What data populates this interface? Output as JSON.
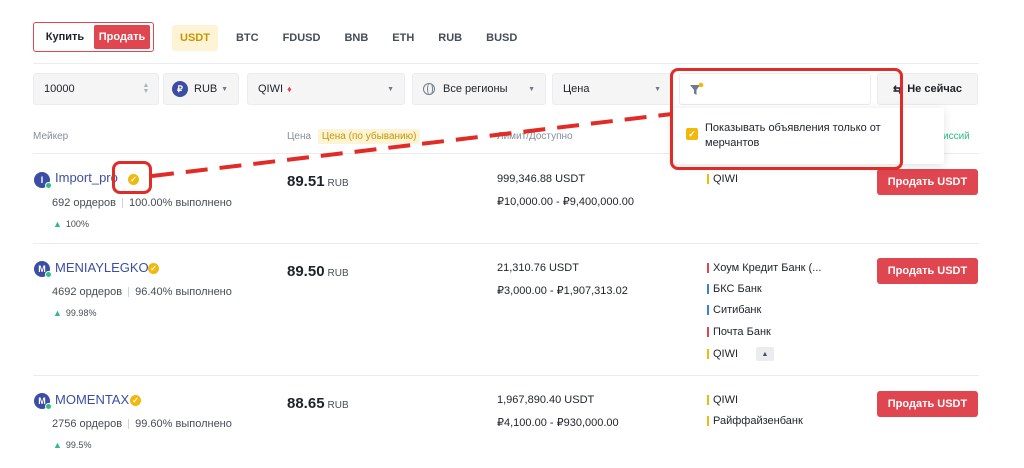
{
  "toggle": {
    "buy": "Купить",
    "sell": "Продать"
  },
  "asset_tabs": [
    "USDT",
    "BTC",
    "FDUSD",
    "BNB",
    "ETH",
    "RUB",
    "BUSD"
  ],
  "filters": {
    "amount": "10000",
    "currency": "RUB",
    "currency_symbol": "₽",
    "payment": "QIWI",
    "region": "Все регионы",
    "sort": "Цена",
    "not_now": "Не сейчас"
  },
  "popup": {
    "checkbox_label": "Показывать объявления только от мерчантов",
    "checked": true
  },
  "table_header": {
    "maker": "Мейкер",
    "price": "Цена",
    "price_order": "Цена (по убыванию)",
    "limit_available": "Лимит/Доступно",
    "no_commission_fragment": "иссий"
  },
  "rows": [
    {
      "avatar_letter": "I",
      "name": "Import_pro",
      "orders": "692 ордеров",
      "completion": "100.00% выполнено",
      "rating": "100%",
      "price": "89.51",
      "price_currency": "RUB",
      "available": "999,346.88 USDT",
      "limits": "₽10,000.00 - ₽9,400,000.00",
      "payments": [
        {
          "name": "QIWI",
          "color": "#f0b90b"
        }
      ],
      "action": "Продать USDT"
    },
    {
      "avatar_letter": "M",
      "name": "MENIAYLEGKO",
      "orders": "4692 ордеров",
      "completion": "96.40% выполнено",
      "rating": "99.98%",
      "price": "89.50",
      "price_currency": "RUB",
      "available": "21,310.76 USDT",
      "limits": "₽3,000.00 - ₽1,907,313.02",
      "payments": [
        {
          "name": "Хоум Кредит Банк (...",
          "color": "#e0464f"
        },
        {
          "name": "БКС Банк",
          "color": "#3c7fd9"
        },
        {
          "name": "Ситибанк",
          "color": "#3c7fd9"
        },
        {
          "name": "Почта Банк",
          "color": "#e0464f"
        },
        {
          "name": "QIWI",
          "color": "#f0b90b"
        }
      ],
      "action": "Продать USDT"
    },
    {
      "avatar_letter": "M",
      "name": "MOMENTAX",
      "orders": "2756 ордеров",
      "completion": "99.60% выполнено",
      "rating": "99.5%",
      "price": "88.65",
      "price_currency": "RUB",
      "available": "1,967,890.40 USDT",
      "limits": "₽4,100.00 - ₽930,000.00",
      "payments": [
        {
          "name": "QIWI",
          "color": "#f0b90b"
        },
        {
          "name": "Райффайзенбанк",
          "color": "#f0b90b"
        }
      ],
      "action": "Продать USDT"
    }
  ],
  "colors": {
    "sell": "#e0464f",
    "accent": "#f0b90b",
    "annotation": "#e02b26",
    "merchant": "#3c4ea3"
  },
  "icons": [
    "filter-icon",
    "refresh-icon",
    "verified-badge-icon",
    "globe-icon",
    "thumbs-up-icon",
    "fire-icon"
  ]
}
